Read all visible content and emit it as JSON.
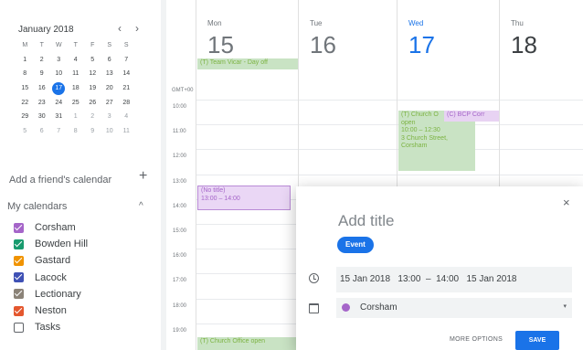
{
  "mini_calendar": {
    "title": "January 2018",
    "prev": "‹",
    "next": "›",
    "dow": [
      "M",
      "T",
      "W",
      "T",
      "F",
      "S",
      "S"
    ],
    "weeks": [
      [
        {
          "d": "1"
        },
        {
          "d": "2"
        },
        {
          "d": "3"
        },
        {
          "d": "4"
        },
        {
          "d": "5"
        },
        {
          "d": "6"
        },
        {
          "d": "7"
        }
      ],
      [
        {
          "d": "8"
        },
        {
          "d": "9"
        },
        {
          "d": "10"
        },
        {
          "d": "11"
        },
        {
          "d": "12"
        },
        {
          "d": "13"
        },
        {
          "d": "14"
        }
      ],
      [
        {
          "d": "15"
        },
        {
          "d": "16"
        },
        {
          "d": "17",
          "today": true
        },
        {
          "d": "18"
        },
        {
          "d": "19"
        },
        {
          "d": "20"
        },
        {
          "d": "21"
        }
      ],
      [
        {
          "d": "22"
        },
        {
          "d": "23"
        },
        {
          "d": "24"
        },
        {
          "d": "25"
        },
        {
          "d": "26"
        },
        {
          "d": "27"
        },
        {
          "d": "28"
        }
      ],
      [
        {
          "d": "29"
        },
        {
          "d": "30"
        },
        {
          "d": "31"
        },
        {
          "d": "1",
          "other": true
        },
        {
          "d": "2",
          "other": true
        },
        {
          "d": "3",
          "other": true
        },
        {
          "d": "4",
          "other": true
        }
      ],
      [
        {
          "d": "5",
          "other": true
        },
        {
          "d": "6",
          "other": true
        },
        {
          "d": "7",
          "other": true
        },
        {
          "d": "8",
          "other": true
        },
        {
          "d": "9",
          "other": true
        },
        {
          "d": "10",
          "other": true
        },
        {
          "d": "11",
          "other": true
        }
      ]
    ]
  },
  "friend": {
    "placeholder": "Add a friend's calendar",
    "plus": "+"
  },
  "my_calendars": {
    "heading": "My calendars",
    "chevron": "^",
    "items": [
      {
        "label": "Corsham",
        "color": "#a565c9",
        "checked": true
      },
      {
        "label": "Bowden Hill",
        "color": "#189b6e",
        "checked": true
      },
      {
        "label": "Gastard",
        "color": "#f09300",
        "checked": true
      },
      {
        "label": "Lacock",
        "color": "#3f51b5",
        "checked": true
      },
      {
        "label": "Lectionary",
        "color": "#8b8378",
        "checked": true
      },
      {
        "label": "Neston",
        "color": "#e4572e",
        "checked": true
      },
      {
        "label": "Tasks",
        "color": "#5f6368",
        "checked": false
      }
    ]
  },
  "days": [
    {
      "name": "Mon",
      "num": "15"
    },
    {
      "name": "Tue",
      "num": "16"
    },
    {
      "name": "Wed",
      "num": "17",
      "today": true
    },
    {
      "name": "Thu",
      "num": "18"
    }
  ],
  "timezone": "GMT+00",
  "times": [
    "10:00",
    "11:00",
    "12:00",
    "13:00",
    "14:00",
    "15:00",
    "16:00",
    "17:00",
    "18:00",
    "19:00"
  ],
  "events": {
    "vicar": "(T) Team Vicar - Day off",
    "church_a_title": "(T) Church O",
    "church_a_line2": "open",
    "church_a_time": "10:00 – 12:30",
    "church_a_place": "3 Church Street,",
    "church_a_town": "Corsham",
    "bcp": "(C) BCP Corr",
    "notitle_title": "(No title)",
    "notitle_time": "13:00 – 14:00",
    "church_b": "(T) Church Office open"
  },
  "popup": {
    "close": "×",
    "title_placeholder": "Add title",
    "event_chip": "Event",
    "time_text": "15 Jan 2018   13:00  –  14:00   15 Jan 2018",
    "calendar": "Corsham",
    "calendar_color": "#a565c9",
    "caret": "▾",
    "more_options": "MORE OPTIONS",
    "save": "SAVE"
  }
}
